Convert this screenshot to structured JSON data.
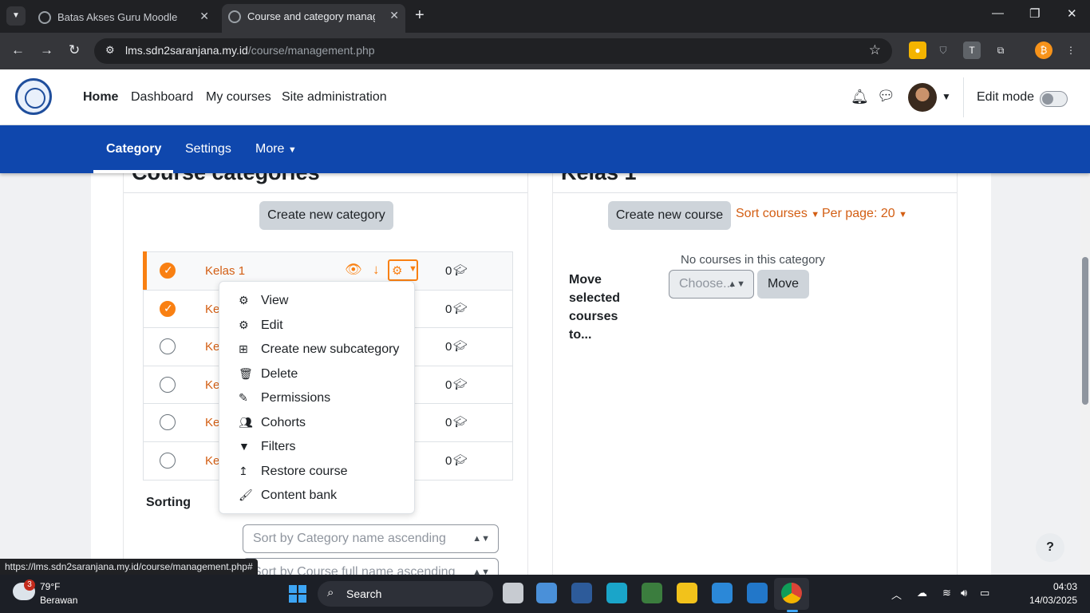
{
  "browser": {
    "tabs": [
      {
        "title": "Batas Akses Guru Moodle"
      },
      {
        "title": "Course and category managem"
      }
    ],
    "url_host": "lms.sdn2saranjana.my.id",
    "url_path": "/course/management.php",
    "status_url": "https://lms.sdn2saranjana.my.id/course/management.php#"
  },
  "navbar": {
    "links": [
      "Home",
      "Dashboard",
      "My courses",
      "Site administration"
    ],
    "edit_mode_label": "Edit mode"
  },
  "secondary_nav": {
    "items": [
      "Category",
      "Settings",
      "More"
    ]
  },
  "categories_panel": {
    "title": "Course categories",
    "create_button": "Create new category",
    "rows": [
      {
        "name": "Kelas 1",
        "count": "0",
        "checked": true
      },
      {
        "name": "Ke",
        "count": "0",
        "checked": true
      },
      {
        "name": "Ke",
        "count": "0",
        "checked": false
      },
      {
        "name": "Ke",
        "count": "0",
        "checked": false
      },
      {
        "name": "Ke",
        "count": "0",
        "checked": false
      },
      {
        "name": "Ke",
        "count": "0",
        "checked": false
      }
    ],
    "sorting_label": "Sorting",
    "sort_selects": [
      "Sort by Category name ascending",
      "Sort by Course full name ascending"
    ]
  },
  "action_menu": {
    "items": [
      {
        "label": "View",
        "icon": "gear-icon"
      },
      {
        "label": "Edit",
        "icon": "gear-icon"
      },
      {
        "label": "Create new subcategory",
        "icon": "plus-square-icon"
      },
      {
        "label": "Delete",
        "icon": "trash-icon"
      },
      {
        "label": "Permissions",
        "icon": "pencil-square-icon"
      },
      {
        "label": "Cohorts",
        "icon": "users-icon"
      },
      {
        "label": "Filters",
        "icon": "filter-icon"
      },
      {
        "label": "Restore course",
        "icon": "restore-arrow-icon"
      },
      {
        "label": "Content bank",
        "icon": "brush-icon"
      }
    ]
  },
  "courses_panel": {
    "title": "Kelas 1",
    "create_button": "Create new course",
    "sort_link": "Sort courses",
    "per_page_link": "Per page: 20",
    "empty_text": "No courses in this category",
    "move_label": "Move selected courses to...",
    "move_select_placeholder": "Choose...",
    "move_button": "Move"
  },
  "help_button": "?",
  "taskbar": {
    "weather_temp": "79°F",
    "weather_desc": "Berawan",
    "weather_badge": "3",
    "search": "Search",
    "time": "04:03",
    "date": "14/03/2025"
  },
  "colors": {
    "brand_blue": "#0f47ad",
    "accent_orange": "#f98012",
    "link_orange": "#d35e13"
  }
}
